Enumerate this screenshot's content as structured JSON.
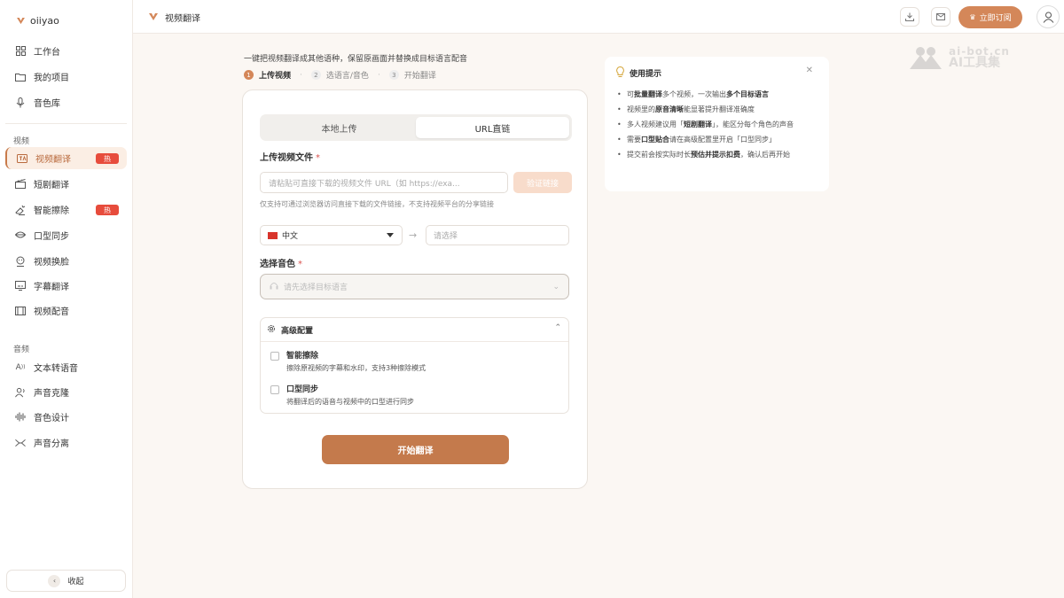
{
  "app": {
    "name": "oiiyao"
  },
  "sidebar": {
    "top_items": [
      {
        "label": "工作台",
        "icon": "grid-icon"
      },
      {
        "label": "我的项目",
        "icon": "folder-icon"
      },
      {
        "label": "音色库",
        "icon": "mic-icon"
      }
    ],
    "video_section": "视频",
    "video_items": [
      {
        "label": "视频翻译",
        "icon": "video-translate-icon",
        "badge": "热",
        "active": true
      },
      {
        "label": "短剧翻译",
        "icon": "clapper-icon"
      },
      {
        "label": "智能擦除",
        "icon": "eraser-icon",
        "badge": "热"
      },
      {
        "label": "口型同步",
        "icon": "lips-icon"
      },
      {
        "label": "视频换脸",
        "icon": "face-swap-icon"
      },
      {
        "label": "字幕翻译",
        "icon": "subtitle-icon"
      },
      {
        "label": "视频配音",
        "icon": "film-icon"
      }
    ],
    "audio_section": "音频",
    "audio_items": [
      {
        "label": "文本转语音",
        "icon": "text-to-speech-icon"
      },
      {
        "label": "声音克隆",
        "icon": "voice-clone-icon"
      },
      {
        "label": "音色设计",
        "icon": "waveform-icon"
      },
      {
        "label": "声音分离",
        "icon": "split-icon"
      }
    ],
    "collapse_label": "收起"
  },
  "topbar": {
    "title": "视频翻译",
    "subscribe_label": "立即订阅"
  },
  "main": {
    "intro": "一键把视频翻译成其他语种，保留原画面并替换成目标语言配音",
    "steps": [
      "上传视频",
      "选语言/音色",
      "开始翻译"
    ],
    "tabs": [
      "本地上传",
      "URL直链"
    ],
    "upload_label": "上传视频文件",
    "required_mark": "*",
    "url_placeholder": "请粘贴可直接下载的视频文件 URL（如 https://exa...",
    "verify_label": "验证链接",
    "url_hint": "仅支持可通过浏览器访问直接下载的文件链接，不支持视频平台的分享链接",
    "source_lang": "中文",
    "target_placeholder": "请选择",
    "voice_label": "选择音色",
    "voice_placeholder": "请先选择目标语言",
    "advanced_label": "高级配置",
    "options": [
      {
        "title": "智能擦除",
        "desc": "擦除原视频的字幕和水印，支持3种擦除模式"
      },
      {
        "title": "口型同步",
        "desc": "将翻译后的语音与视频中的口型进行同步"
      }
    ],
    "start_label": "开始翻译"
  },
  "tips": {
    "title": "使用提示",
    "items": [
      {
        "pre": "可",
        "bold1": "批量翻译",
        "mid": "多个视频，一次输出",
        "bold2": "多个目标语言",
        "post": ""
      },
      {
        "pre": "视频里的",
        "bold1": "原音清晰",
        "mid": "能显著提升翻译准确度",
        "bold2": "",
        "post": ""
      },
      {
        "pre": "多人视频建议用「",
        "bold1": "短剧翻译",
        "mid": "」，能区分每个角色的声音",
        "bold2": "",
        "post": ""
      },
      {
        "pre": "需要",
        "bold1": "口型贴合",
        "mid": "请在高级配置里开启「口型同步」",
        "bold2": "",
        "post": ""
      },
      {
        "pre": "提交前会按实际时长",
        "bold1": "预估并提示扣费",
        "mid": "，确认后再开始",
        "bold2": "",
        "post": ""
      }
    ]
  },
  "watermark": {
    "line1": "ai-bot.cn",
    "line2": "AI工具集"
  },
  "colors": {
    "accent": "#d48759",
    "accent_dark": "#c47a4c",
    "hot_badge": "#e74c3c"
  }
}
